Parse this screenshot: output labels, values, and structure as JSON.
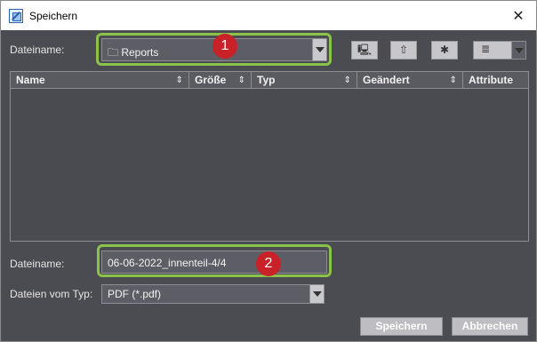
{
  "window": {
    "title": "Speichern",
    "close_glyph": "✕"
  },
  "top": {
    "dateiname_label": "Dateiname:",
    "folder_value": "🗀 Reports",
    "badge1": "1",
    "tools": [
      {
        "icon": "computer-icon",
        "glyph": "🖳"
      },
      {
        "icon": "folder-up-icon",
        "glyph": "⇧"
      },
      {
        "icon": "new-folder-icon",
        "glyph": "✱"
      },
      {
        "icon": "list-view-icon",
        "glyph": "≣"
      }
    ]
  },
  "filelist": {
    "columns": [
      {
        "label": "Name",
        "sort": "⇕"
      },
      {
        "label": "Größe",
        "sort": "⇕"
      },
      {
        "label": "Typ",
        "sort": "⇕"
      },
      {
        "label": "Geändert",
        "sort": "⇕"
      },
      {
        "label": "Attribute",
        "sort": ""
      }
    ]
  },
  "bottom": {
    "dateiname_label": "Dateiname:",
    "filename_value": "06-06-2022_innenteil-4/4",
    "badge2": "2",
    "filetype_label": "Dateien vom Typ:",
    "filetype_value": "PDF (*.pdf)"
  },
  "buttons": {
    "save": "Speichern",
    "cancel": "Abbrechen"
  },
  "colors": {
    "background": "#4b4b52",
    "highlight": "#8bc34a",
    "badge": "#c82128"
  }
}
